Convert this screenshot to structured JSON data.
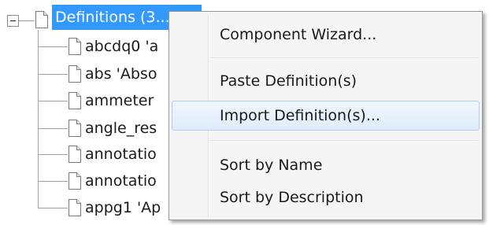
{
  "tree": {
    "root": {
      "label": "Definitions (3..."
    },
    "children": [
      {
        "label": "abcdq0 'a"
      },
      {
        "label": "abs 'Abso"
      },
      {
        "label": "ammeter"
      },
      {
        "label": "angle_res"
      },
      {
        "label": "annotatio"
      },
      {
        "label": "annotatio"
      },
      {
        "label": "appg1 'Ap"
      }
    ]
  },
  "context_menu": {
    "items": [
      {
        "label": "Component Wizard..."
      },
      {
        "label": "Paste Definition(s)"
      },
      {
        "label": "Import Definition(s)...",
        "state": "hover"
      },
      {
        "label": "Sort by Name"
      },
      {
        "label": "Sort by Description"
      }
    ]
  },
  "colors": {
    "selection": "#3399ff",
    "menu_background": "#f5f5f5",
    "menu_hover_border": "#aecff7",
    "tree_line": "#a0a0a0"
  }
}
